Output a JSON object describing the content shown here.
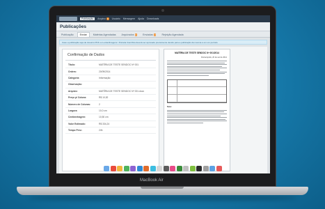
{
  "topnav": {
    "items": [
      "Publicação",
      "Arquivo",
      "Usuário",
      "Mensagem",
      "Ajuda",
      "Downloads"
    ],
    "arquivo_badge": "6"
  },
  "page": {
    "title": "Publicações"
  },
  "tabs": [
    {
      "label": "Publicação"
    },
    {
      "label": "Enviar"
    },
    {
      "label": "Matérias Agendadas"
    },
    {
      "label": "Arquivados",
      "badge": "6"
    },
    {
      "label": "Enviadas",
      "badge": "3"
    },
    {
      "label": "Rejeição Agendada"
    }
  ],
  "notice": "Caso a publicação seja de Assunto PDF ou Letras/Imagens / Portaria Científica deverá ser aprovado previamente devido para a publicação da mesma é em um período",
  "form": {
    "title": "Confirmação de Dados",
    "rows": [
      {
        "label": "Título:",
        "value": "MATÉRIA DE TESTE SENDOC Nº 001"
      },
      {
        "label": "Ordem:",
        "value": "20/09/2014"
      },
      {
        "label": "Categoria:",
        "value": "Informação"
      },
      {
        "label": "Observação:",
        "value": ""
      },
      {
        "label": "Arquivo:",
        "value": "MATÉRIA DE TESTE SENDOC Nº 001.docx"
      },
      {
        "label": "Preço p/ Coluna:",
        "value": "R$ 10,52"
      },
      {
        "label": "Número de Colunas:",
        "value": "2"
      },
      {
        "label": "Largura:",
        "value": "10,0 cm"
      },
      {
        "label": "Centimetragem:",
        "value": "10,50 cm"
      },
      {
        "label": "Valor Estimado:",
        "value": "R$ 334,24"
      },
      {
        "label": "Tempo Prev.:",
        "value": "24h"
      }
    ]
  },
  "preview": {
    "title": "MATÉRIA DE TESTE SENDOC Nº 001/2014",
    "date": "Florianópolis, 20 de set de 2014",
    "note": "Nota:"
  },
  "dock_colors": [
    "#6aa8e8",
    "#e94b3c",
    "#f3b73c",
    "#4fb35c",
    "#8d63d1",
    "#2f8bd6",
    "#e06c2c",
    "#3dbde0",
    "#d6d6d6",
    "#5c5c5c",
    "#e74c88",
    "#3a8b3a",
    "#c0c0c0",
    "#7fbf3f",
    "#2b2b2b",
    "#a0a0a0",
    "#5da2e3",
    "#e65a5a"
  ],
  "laptop": {
    "brand": "MacBook Air"
  }
}
